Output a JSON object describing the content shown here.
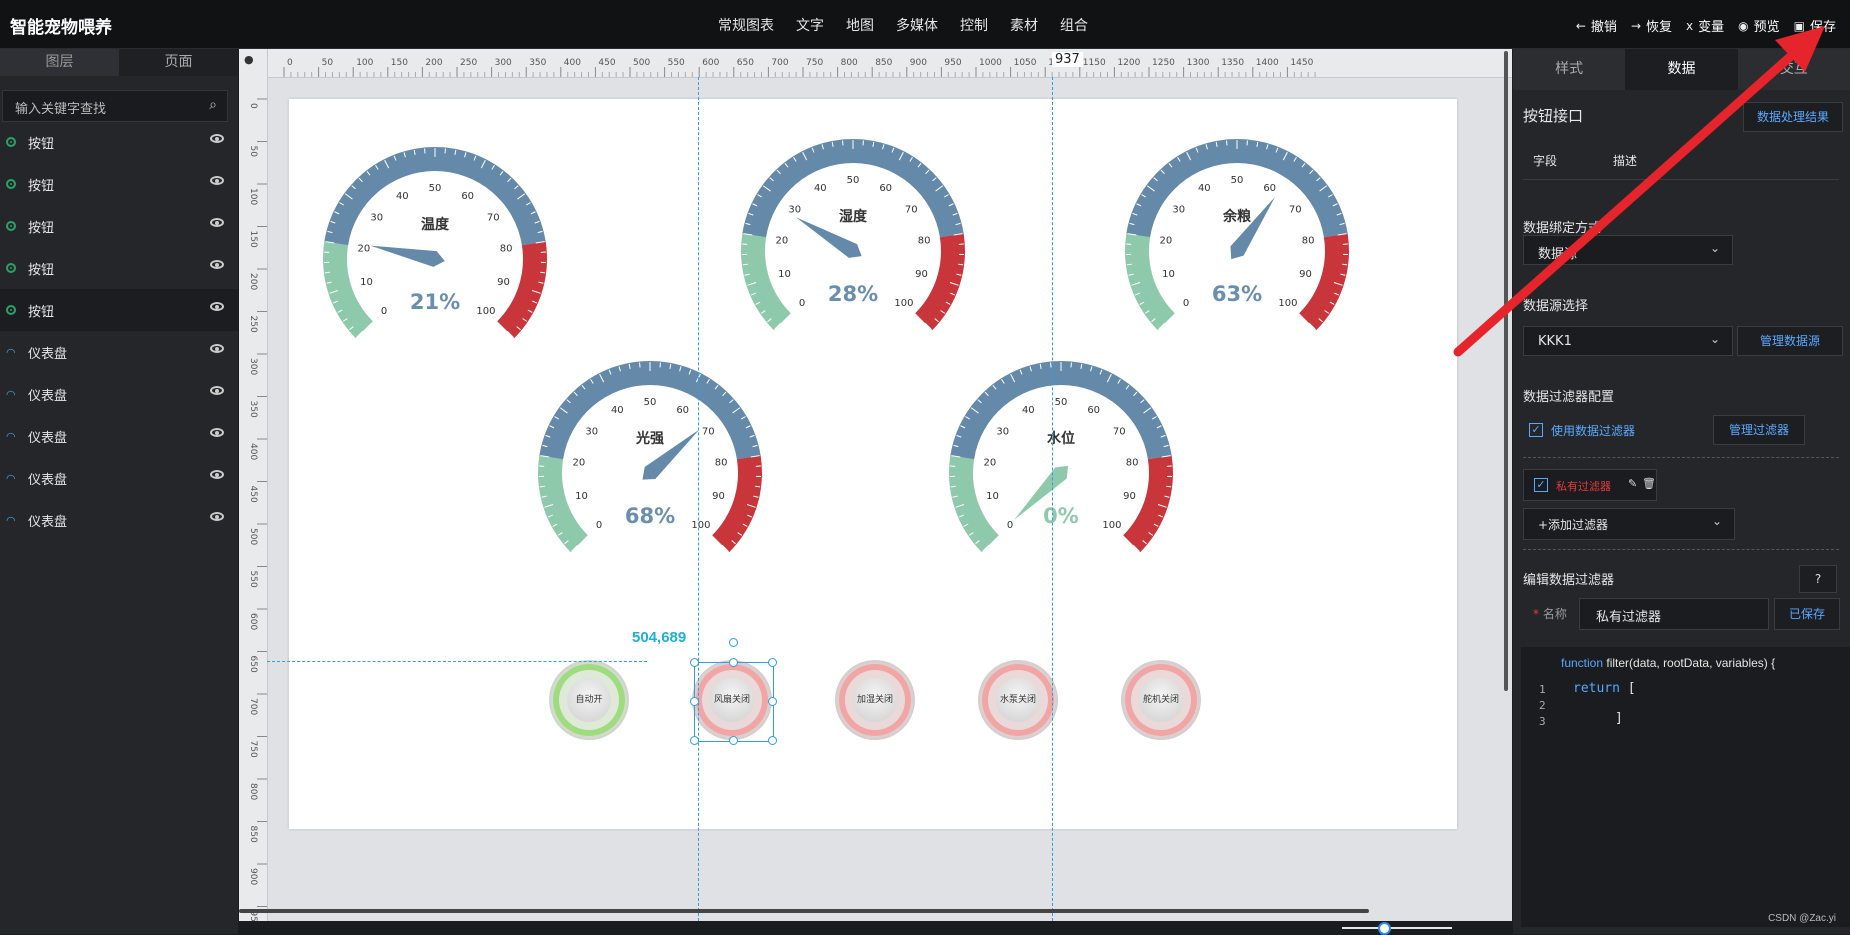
{
  "app": {
    "title": "智能宠物喂养"
  },
  "menu": [
    "常规图表",
    "文字",
    "地图",
    "多媒体",
    "控制",
    "素材",
    "组合"
  ],
  "actions": [
    {
      "icon": "undo-icon",
      "glyph": "←",
      "label": "撤销"
    },
    {
      "icon": "redo-icon",
      "glyph": "→",
      "label": "恢复"
    },
    {
      "icon": "variable-icon",
      "glyph": "x",
      "label": "变量"
    },
    {
      "icon": "preview-eye-icon",
      "glyph": "◉",
      "label": "预览"
    },
    {
      "icon": "save-icon",
      "glyph": "▣",
      "label": "保存"
    }
  ],
  "left_panel": {
    "tabs": [
      "图层",
      "页面"
    ],
    "search_placeholder": "输入关键字查找",
    "layers": [
      {
        "name": "按钮",
        "type": "button"
      },
      {
        "name": "按钮",
        "type": "button"
      },
      {
        "name": "按钮",
        "type": "button"
      },
      {
        "name": "按钮",
        "type": "button"
      },
      {
        "name": "按钮",
        "type": "button",
        "selected": true
      },
      {
        "name": "仪表盘",
        "type": "gauge"
      },
      {
        "name": "仪表盘",
        "type": "gauge"
      },
      {
        "name": "仪表盘",
        "type": "gauge"
      },
      {
        "name": "仪表盘",
        "type": "gauge"
      },
      {
        "name": "仪表盘",
        "type": "gauge"
      }
    ]
  },
  "canvas": {
    "ruler_top_labels": [
      "0",
      "50",
      "100",
      "150",
      "200",
      "250",
      "300",
      "350",
      "400",
      "450",
      "500",
      "550",
      "600",
      "650",
      "700",
      "750",
      "800",
      "850",
      "900",
      "950",
      "1000",
      "1050",
      "1100",
      "1150",
      "1200",
      "1250",
      "1300",
      "1350",
      "1400",
      "1450"
    ],
    "ruler_left_labels": [
      "0",
      "50",
      "100",
      "150",
      "200",
      "250",
      "300",
      "350",
      "400",
      "450",
      "500",
      "550",
      "600",
      "650",
      "700",
      "750",
      "800",
      "850",
      "900",
      "950"
    ],
    "cursor_readout": "937",
    "coord_readout": "504,689",
    "gauges": [
      {
        "title": "温度",
        "value": 21,
        "display": "21%",
        "ticks": [
          "0",
          "10",
          "20",
          "30",
          "40",
          "50",
          "60",
          "70",
          "80",
          "90",
          "100"
        ]
      },
      {
        "title": "湿度",
        "value": 28,
        "display": "28%",
        "ticks": [
          "0",
          "10",
          "20",
          "30",
          "40",
          "50",
          "60",
          "70",
          "80",
          "90",
          "100"
        ]
      },
      {
        "title": "余粮",
        "value": 63,
        "display": "63%",
        "ticks": [
          "0",
          "10",
          "20",
          "30",
          "40",
          "50",
          "60",
          "70",
          "80",
          "90",
          "100"
        ]
      },
      {
        "title": "光强",
        "value": 68,
        "display": "68%",
        "ticks": [
          "0",
          "10",
          "20",
          "30",
          "40",
          "50",
          "60",
          "70",
          "80",
          "90",
          "100"
        ]
      },
      {
        "title": "水位",
        "value": 0,
        "display": "0%",
        "ticks": [
          "0",
          "10",
          "20",
          "30",
          "40",
          "50",
          "60",
          "70",
          "80",
          "90",
          "100"
        ]
      }
    ],
    "buttons": [
      {
        "label": "自动开",
        "state": "on"
      },
      {
        "label": "风扇关闭",
        "state": "off"
      },
      {
        "label": "加湿关闭",
        "state": "off"
      },
      {
        "label": "水泵关闭",
        "state": "off"
      },
      {
        "label": "舵机关闭",
        "state": "off"
      }
    ],
    "colors": {
      "gauge_low": "#8fc9ab",
      "gauge_mid": "#6489a9",
      "gauge_high": "#c8353a",
      "value_text": "#6a8eae"
    }
  },
  "right_panel": {
    "tabs": [
      "样式",
      "数据",
      "交互"
    ],
    "interface_title": "按钮接口",
    "process_result_btn": "数据处理结果",
    "col_field": "字段",
    "col_desc": "描述",
    "bind_mode_label": "数据绑定方式",
    "bind_mode_value": "数据源",
    "source_label": "数据源选择",
    "source_value": "KKK1",
    "manage_source_btn": "管理数据源",
    "filter_config_label": "数据过滤器配置",
    "use_filter_label": "使用数据过滤器",
    "manage_filter_btn": "管理过滤器",
    "private_filter_label": "私有过滤器",
    "add_filter_label": "+添加过滤器",
    "edit_filter_label": "编辑数据过滤器",
    "help_btn": "?",
    "name_label": "名称",
    "name_value": "私有过滤器",
    "saved_btn": "已保存",
    "code": {
      "signature_kw": "function",
      "signature_rest": "filter(data, rootData, variables) {",
      "lines": [
        "1",
        "2",
        "3"
      ],
      "return_kw": "return",
      "return_rest": "[",
      "close": "]"
    }
  },
  "credit": "CSDN @Zac.yi"
}
